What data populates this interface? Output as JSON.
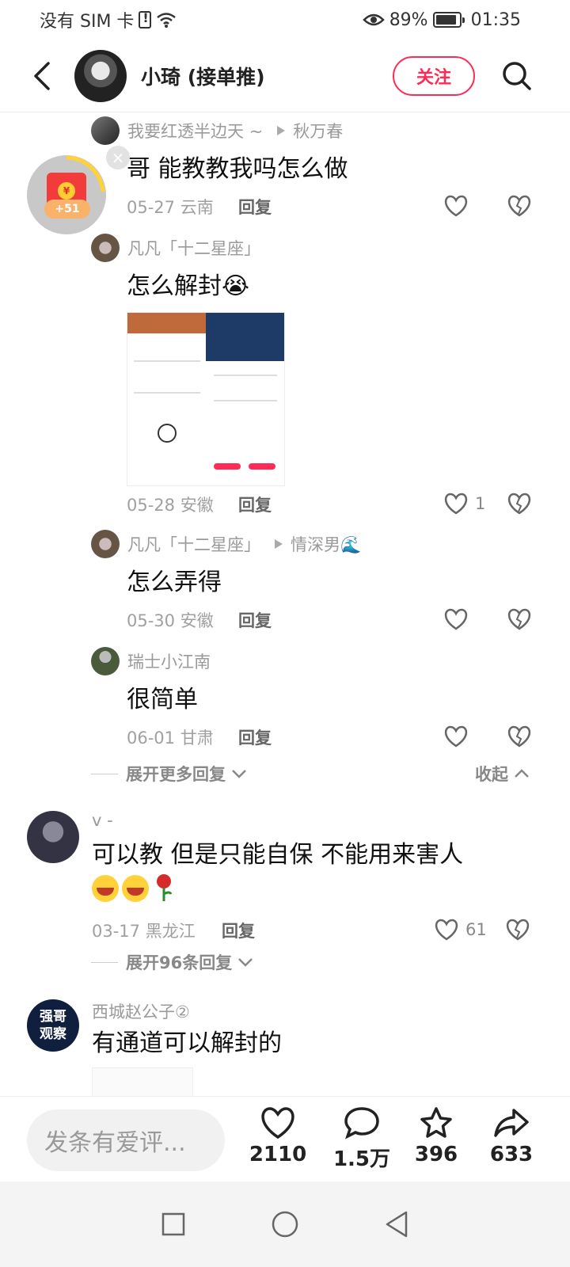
{
  "status_bar": {
    "carrier": "没有 SIM 卡",
    "battery": "89%",
    "battery_level": 0.89,
    "time": "01:35"
  },
  "header": {
    "title": "小琦 (接单推)",
    "follow_label": "关注"
  },
  "red_packet": {
    "amount": "+51",
    "coin": "¥"
  },
  "replies": [
    {
      "user": "我要红透半边天 ~",
      "target": "秋万春",
      "text": "哥  能教教我吗怎么做",
      "date": "05-27 云南",
      "reply_label": "回复",
      "likes": ""
    },
    {
      "user": "凡凡「十二星座」",
      "target": "",
      "text": "怎么解封😭",
      "date": "05-28 安徽",
      "reply_label": "回复",
      "likes": "1"
    },
    {
      "user": "凡凡「十二星座」",
      "target": "情深男🌊",
      "text": "怎么弄得",
      "date": "05-30 安徽",
      "reply_label": "回复",
      "likes": ""
    },
    {
      "user": "瑞士小江南",
      "target": "",
      "text": "很简单",
      "date": "06-01 甘肃",
      "reply_label": "回复",
      "likes": ""
    }
  ],
  "expand_more": "展开更多回复",
  "collapse": "收起",
  "comments": [
    {
      "user": "v -",
      "text": "可以教 但是只能自保 不能用来害人",
      "date": "03-17 黑龙江",
      "reply_label": "回复",
      "likes": "61",
      "expand": "展开96条回复"
    },
    {
      "user": "西城赵公子②",
      "avatar_text": "强哥\n观察",
      "text": "有通道可以解封的"
    }
  ],
  "bottom_bar": {
    "input_placeholder": "发条有爱评...",
    "likes": "2110",
    "comments": "1.5万",
    "favorites": "396",
    "shares": "633"
  },
  "colors": {
    "accent": "#ff2b56",
    "red_packet": "#f23b3b"
  }
}
